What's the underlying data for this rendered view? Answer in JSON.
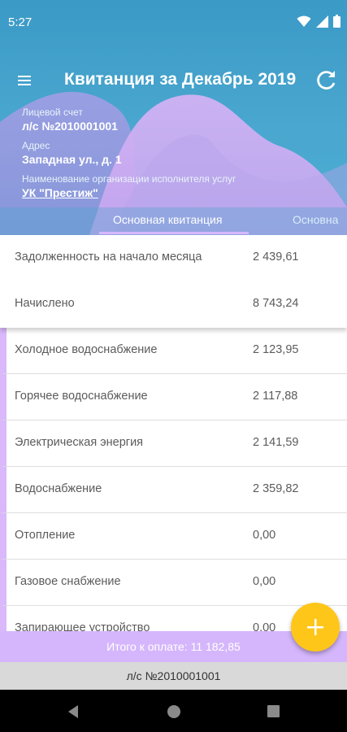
{
  "status_bar": {
    "time": "5:27"
  },
  "toolbar": {
    "title": "Квитанция за Декабрь 2019"
  },
  "account": {
    "label_account": "Лицевой счет",
    "account_number": "л/с №2010001001",
    "label_address": "Адрес",
    "address": "Западная ул., д. 1",
    "label_org": "Наименование организации исполнителя услуг",
    "org_name": "УК \"Престиж\""
  },
  "tabs": [
    {
      "label": "Основная квитанция"
    },
    {
      "label": "Основна"
    }
  ],
  "summary_rows": [
    {
      "label": "Задолженность на начало месяца",
      "value": "2 439,61"
    },
    {
      "label": "Начислено",
      "value": "8 743,24"
    }
  ],
  "service_rows": [
    {
      "label": "Холодное водоснабжение",
      "value": "2 123,95"
    },
    {
      "label": "Горячее водоснабжение",
      "value": "2 117,88"
    },
    {
      "label": "Электрическая энергия",
      "value": "2 141,59"
    },
    {
      "label": "Водоснабжение",
      "value": "2 359,82"
    },
    {
      "label": "Отопление",
      "value": "0,00"
    },
    {
      "label": "Газовое снабжение",
      "value": "0,00"
    },
    {
      "label": "Запирающее устройство",
      "value": "0,00"
    }
  ],
  "total": {
    "text": "Итого к оплате: 11 182,85"
  },
  "bottom_account": {
    "text": "л/с №2010001001"
  },
  "colors": {
    "header_blue": "#4aa7cf",
    "accent_lilac": "#d5b6fc",
    "fab_yellow": "#ffc61a",
    "row_text": "#5b5b5b"
  },
  "icons": {
    "menu": "menu-icon",
    "refresh": "refresh-icon",
    "add": "plus-icon",
    "wifi": "wifi-icon",
    "signal": "signal-icon",
    "battery": "battery-icon",
    "back": "back-icon",
    "home": "home-icon",
    "recents": "recents-icon"
  }
}
